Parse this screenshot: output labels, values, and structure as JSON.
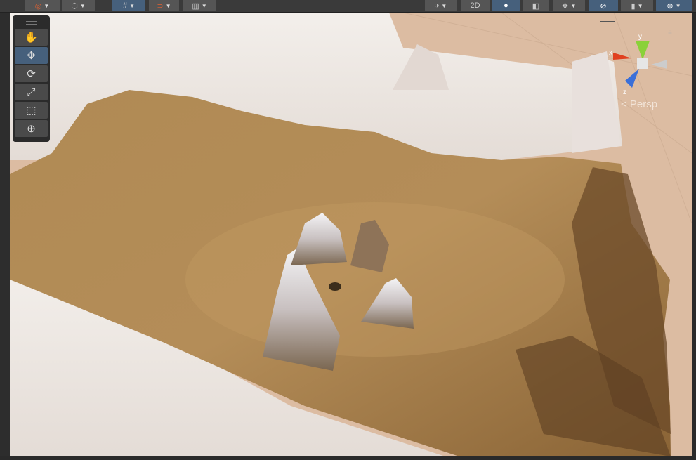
{
  "toolbar": {
    "left": [
      {
        "icon": "draw-mode-icon",
        "dropdown": true
      },
      {
        "icon": "render-mode-icon",
        "dropdown": true
      },
      {
        "icon": "grid-snap-icon",
        "dropdown": true,
        "active": true
      },
      {
        "icon": "magnet-snap-icon",
        "dropdown": true
      },
      {
        "icon": "grid-icon",
        "dropdown": true
      }
    ],
    "right": [
      {
        "icon": "shading-icon",
        "dropdown": true
      },
      {
        "label": "2D"
      },
      {
        "icon": "lighting-icon",
        "active": true
      },
      {
        "icon": "audio-fx-icon"
      },
      {
        "icon": "effects-icon",
        "dropdown": true
      },
      {
        "icon": "visibility-icon",
        "active": true
      },
      {
        "icon": "camera-icon",
        "dropdown": true
      },
      {
        "icon": "gizmos-icon",
        "dropdown": true,
        "active": true
      }
    ]
  },
  "tools": [
    {
      "name": "hand",
      "glyph": "✋"
    },
    {
      "name": "move",
      "glyph": "✥",
      "active": true
    },
    {
      "name": "rotate",
      "glyph": "⟳"
    },
    {
      "name": "scale",
      "glyph": "⤢"
    },
    {
      "name": "rect",
      "glyph": "⬚"
    },
    {
      "name": "transform",
      "glyph": "⊕"
    }
  ],
  "gizmo": {
    "x": "x",
    "y": "y",
    "z": "z",
    "projection": "< Persp",
    "colors": {
      "x": "#e0401f",
      "y": "#8ad13a",
      "z": "#3a6fd8"
    }
  },
  "colors": {
    "terrain": "#a9824d",
    "snow": "#ece6e0",
    "ground": "#dcbca2",
    "accent": "#46607c"
  }
}
